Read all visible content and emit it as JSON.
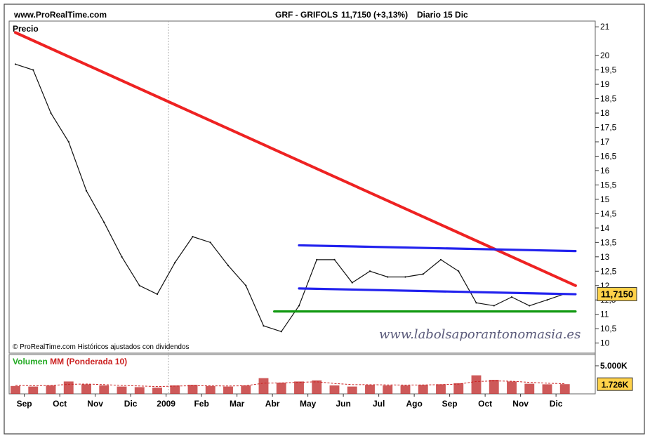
{
  "header": {
    "site": "www.ProRealTime.com",
    "ticker": "GRF - GRIFOLS",
    "quote": "11,7150 (+3,13%)",
    "period": "Diario  15 Dic"
  },
  "watermark": "www.labolsaporantonomasia.es",
  "copyright": "© ProRealTime.com  Históricos ajustados con dividendos",
  "price_panel_label": "Precio",
  "volume_panel_label": {
    "volumen": "Volumen",
    "mm": "MM (Ponderada 10)"
  },
  "colors": {
    "trend_red": "#ee2222",
    "channel_blue": "#2222ee",
    "support_green": "#119911",
    "badge_yellow": "#ffd24a",
    "volume_bar": "#c23030",
    "volume_ma": "#cc2222"
  },
  "chart_data": [
    {
      "type": "line",
      "title": "GRF - GRIFOLS",
      "y_axis_ticks": [
        "21",
        "20",
        "19,5",
        "19",
        "18,5",
        "18",
        "17,5",
        "17",
        "16,5",
        "16",
        "15,5",
        "15",
        "14,5",
        "14",
        "13,5",
        "13",
        "12,5",
        "12",
        "11,5",
        "11",
        "10,5",
        "10"
      ],
      "y_axis_values": [
        21,
        20,
        19.5,
        19,
        18.5,
        18,
        17.5,
        17,
        16.5,
        16,
        15.5,
        15,
        14.5,
        14,
        13.5,
        13,
        12.5,
        12,
        11.5,
        11,
        10.5,
        10
      ],
      "ylim": [
        9.65,
        21.2
      ],
      "x_axis_ticks": [
        "Sep",
        "Oct",
        "Nov",
        "Dic",
        "2009",
        "Feb",
        "Mar",
        "Abr",
        "May",
        "Jun",
        "Jul",
        "Ago",
        "Sep",
        "Oct",
        "Nov",
        "Dic"
      ],
      "x": [
        0,
        0.5,
        1,
        1.5,
        2,
        2.5,
        3,
        3.5,
        4,
        4.5,
        5,
        5.5,
        6,
        6.5,
        7,
        7.5,
        8,
        8.5,
        9,
        9.5,
        10,
        10.5,
        11,
        11.5,
        12,
        12.5,
        13,
        13.5,
        14,
        14.5,
        15,
        15.5
      ],
      "close": [
        19.7,
        19.5,
        18.0,
        17.0,
        15.3,
        14.2,
        13.0,
        12.0,
        11.7,
        12.8,
        13.7,
        13.5,
        12.7,
        12.0,
        10.6,
        10.4,
        11.3,
        12.9,
        12.9,
        12.1,
        12.5,
        12.3,
        12.3,
        12.4,
        12.9,
        12.5,
        11.4,
        11.3,
        11.6,
        11.3,
        11.5,
        11.715
      ],
      "last_value_badge": "11,7150",
      "trendlines": [
        {
          "name": "bajista",
          "color": "red",
          "points": [
            [
              0,
              20.8
            ],
            [
              15.8,
              12.0
            ]
          ]
        },
        {
          "name": "canal-superior",
          "color": "blue",
          "points": [
            [
              8.0,
              13.4
            ],
            [
              15.8,
              13.2
            ]
          ]
        },
        {
          "name": "canal-inferior",
          "color": "blue",
          "points": [
            [
              8.0,
              11.9
            ],
            [
              15.8,
              11.7
            ]
          ]
        },
        {
          "name": "soporte",
          "color": "green",
          "points": [
            [
              7.3,
              11.1
            ],
            [
              15.8,
              11.1
            ]
          ]
        }
      ],
      "grid": false
    },
    {
      "type": "bar",
      "title": "Volumen",
      "y_axis_ticks": [
        "5.000K"
      ],
      "y_axis_values": [
        5000
      ],
      "ylim": [
        0,
        7000
      ],
      "last_value_badge": "1.726K",
      "x": [
        0,
        0.5,
        1,
        1.5,
        2,
        2.5,
        3,
        3.5,
        4,
        4.5,
        5,
        5.5,
        6,
        6.5,
        7,
        7.5,
        8,
        8.5,
        9,
        9.5,
        10,
        10.5,
        11,
        11.5,
        12,
        12.5,
        13,
        13.5,
        14,
        14.5,
        15,
        15.5
      ],
      "values": [
        1400,
        1300,
        1500,
        2200,
        1700,
        1500,
        1300,
        1200,
        1100,
        1500,
        1600,
        1400,
        1300,
        1500,
        2800,
        2000,
        2200,
        2400,
        1500,
        1300,
        1600,
        1500,
        1500,
        1600,
        1700,
        1900,
        3300,
        2500,
        2200,
        1800,
        1700,
        1726
      ],
      "ma": [
        1500,
        1450,
        1480,
        1700,
        1750,
        1650,
        1500,
        1400,
        1300,
        1380,
        1450,
        1430,
        1400,
        1450,
        1900,
        1950,
        2050,
        2150,
        1850,
        1650,
        1630,
        1600,
        1570,
        1590,
        1640,
        1740,
        2200,
        2300,
        2250,
        2050,
        1900,
        1800
      ]
    }
  ]
}
